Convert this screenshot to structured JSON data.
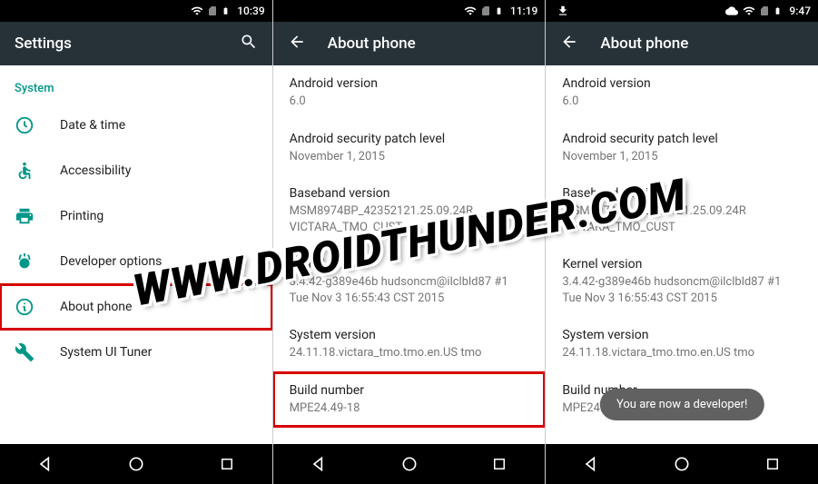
{
  "watermark": "WWW.DROIDTHUNDER.COM",
  "panel1": {
    "statusbar": {
      "time": "10:39"
    },
    "appbar": {
      "title": "Settings"
    },
    "section": "System",
    "items": [
      {
        "name": "date-time",
        "label": "Date & time"
      },
      {
        "name": "accessibility",
        "label": "Accessibility"
      },
      {
        "name": "printing",
        "label": "Printing"
      },
      {
        "name": "developer-options",
        "label": "Developer options"
      },
      {
        "name": "about-phone",
        "label": "About phone"
      },
      {
        "name": "system-ui-tuner",
        "label": "System UI Tuner"
      }
    ]
  },
  "panel2": {
    "statusbar": {
      "time": "11:19"
    },
    "appbar": {
      "title": "About phone"
    },
    "info": {
      "android_version_label": "Android version",
      "android_version_value": "6.0",
      "patch_label": "Android security patch level",
      "patch_value": "November 1, 2015",
      "baseband_label": "Baseband version",
      "baseband_value": "MSM8974BP_42352121.25.09.24R\nVICTARA_TMO_CUST",
      "kernel_label": "Kernel version",
      "kernel_value": "3.4.42-g389e46b\nhudsoncm@ilclbld87 #1\nTue Nov 3 16:55:43 CST 2015",
      "system_label": "System version",
      "system_value": "24.11.18.victara_tmo.tmo.en.US tmo",
      "build_label": "Build number",
      "build_value": "MPE24.49-18"
    }
  },
  "panel3": {
    "statusbar": {
      "time": "9:47"
    },
    "appbar": {
      "title": "About phone"
    },
    "info": {
      "android_version_label": "Android version",
      "android_version_value": "6.0",
      "patch_label": "Android security patch level",
      "patch_value": "November 1, 2015",
      "baseband_label": "Baseband version",
      "baseband_value": "MSM8974BP_42352121.25.09.24R\nVICTARA_TMO_CUST",
      "kernel_label": "Kernel version",
      "kernel_value": "3.4.42-g389e46b\nhudsoncm@ilclbld87 #1\nTue Nov 3 16:55:43 CST 2015",
      "system_label": "System version",
      "system_value": "24.11.18.victara_tmo.tmo.en.US tmo",
      "build_label": "Build number",
      "build_value": "MPE24.49-18"
    },
    "toast": "You are now a developer!"
  }
}
